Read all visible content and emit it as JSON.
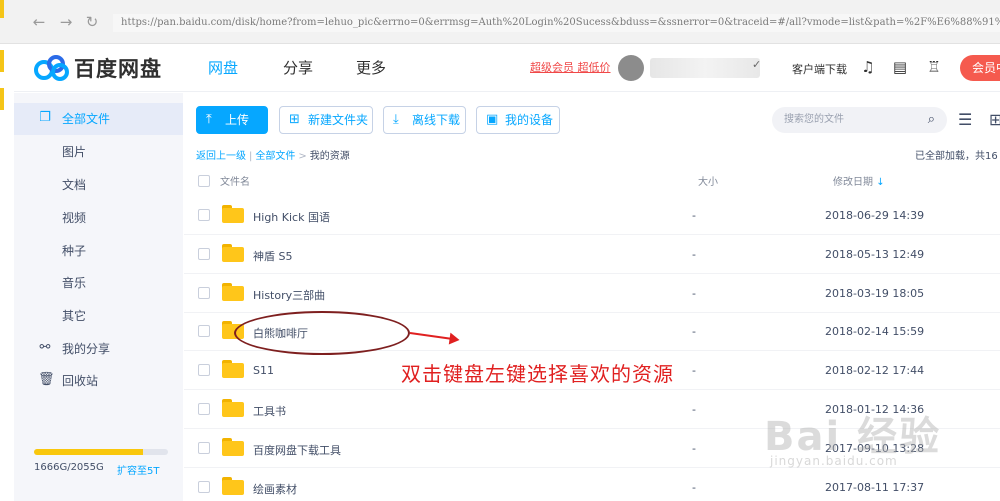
{
  "browser": {
    "url": "https://pan.baidu.com/disk/home?from=lehuo_pic&errno=0&errmsg=Auth%20Login%20Sucess&bduss=&ssnerror=0&traceid=#/all?vmode=list&path=%2F%E6%88%91%E7%9A%84%E8%B5%84%E6%BA%90"
  },
  "header": {
    "logo_text": "百度网盘",
    "nav": [
      "网盘",
      "分享",
      "更多"
    ],
    "promo": "超级会员 超低价",
    "client_download": "客户端下载",
    "vip_button": "会员中"
  },
  "sidebar": {
    "items": [
      {
        "label": "全部文件",
        "icon": "file-icon"
      },
      {
        "label": "图片"
      },
      {
        "label": "文档"
      },
      {
        "label": "视频"
      },
      {
        "label": "种子"
      },
      {
        "label": "音乐"
      },
      {
        "label": "其它"
      },
      {
        "label": "我的分享",
        "icon": "share-icon"
      },
      {
        "label": "回收站",
        "icon": "trash-icon"
      }
    ],
    "quota_text": "1666G/2055G",
    "quota_fraction": 0.81,
    "expand_link": "扩容至5T"
  },
  "toolbar": {
    "upload": "上传",
    "new_folder": "新建文件夹",
    "offline_download": "离线下载",
    "my_devices": "我的设备",
    "search_placeholder": "搜索您的文件"
  },
  "breadcrumb": {
    "back": "返回上一级",
    "all_files": "全部文件",
    "current": "我的资源",
    "loaded_text": "已全部加载，共16"
  },
  "table": {
    "headers": {
      "name": "文件名",
      "size": "大小",
      "modified": "修改日期"
    },
    "rows": [
      {
        "name": "High Kick 国语",
        "size": "-",
        "modified": "2018-06-29 14:39"
      },
      {
        "name": "神盾 S5",
        "size": "-",
        "modified": "2018-05-13 12:49"
      },
      {
        "name": "History三部曲",
        "size": "-",
        "modified": "2018-03-19 18:05"
      },
      {
        "name": "白熊咖啡厅",
        "size": "-",
        "modified": "2018-02-14 15:59"
      },
      {
        "name": "S11",
        "size": "-",
        "modified": "2018-02-12 17:44"
      },
      {
        "name": "工具书",
        "size": "-",
        "modified": "2018-01-12 14:36"
      },
      {
        "name": "百度网盘下载工具",
        "size": "-",
        "modified": "2017-09-10 13:28"
      },
      {
        "name": "绘画素材",
        "size": "-",
        "modified": "2017-08-11 17:37"
      }
    ]
  },
  "annotation": {
    "text": "双击键盘左键选择喜欢的资源",
    "color": "#e02020"
  },
  "watermark": {
    "main": "Bai 经验",
    "sub": "jingyan.baidu.com"
  },
  "colors": {
    "accent": "#06a7ff",
    "vip": "#f55a4e",
    "folder": "#ffc61a",
    "quota": "#f9c70c"
  }
}
